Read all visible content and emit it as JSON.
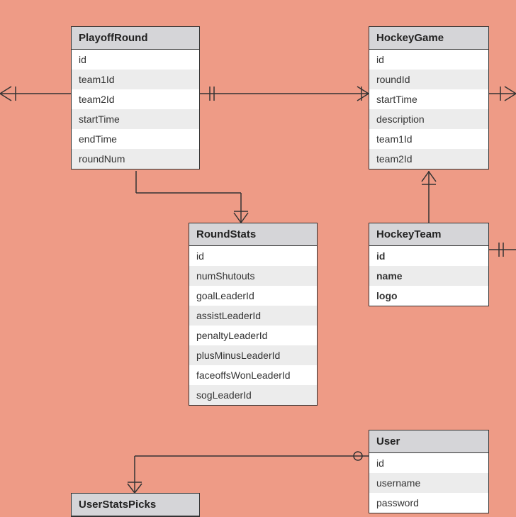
{
  "entities": {
    "playoffRound": {
      "title": "PlayoffRound",
      "fields": [
        "id",
        "team1Id",
        "team2Id",
        "startTime",
        "endTime",
        "roundNum"
      ]
    },
    "hockeyGame": {
      "title": "HockeyGame",
      "fields": [
        "id",
        "roundId",
        "startTime",
        "description",
        "team1Id",
        "team2Id"
      ]
    },
    "roundStats": {
      "title": "RoundStats",
      "fields": [
        "id",
        "numShutouts",
        "goalLeaderId",
        "assistLeaderId",
        "penaltyLeaderId",
        "plusMinusLeaderId",
        "faceoffsWonLeaderId",
        "sogLeaderId"
      ]
    },
    "hockeyTeam": {
      "title": "HockeyTeam",
      "fields": [
        "id",
        "name",
        "logo"
      ]
    },
    "user": {
      "title": "User",
      "fields": [
        "id",
        "username",
        "password"
      ]
    },
    "userStatsPicks": {
      "title": "UserStatsPicks",
      "fields": []
    }
  }
}
